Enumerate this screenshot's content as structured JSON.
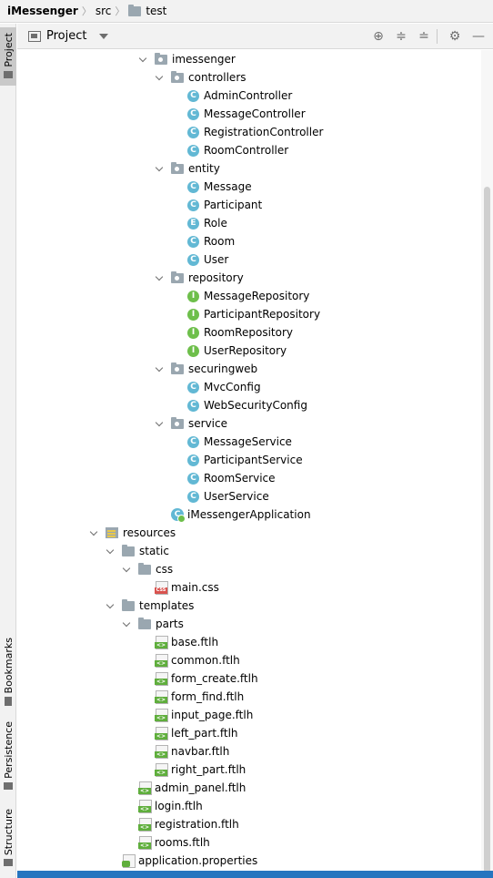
{
  "breadcrumb": {
    "project": "iMessenger",
    "src": "src",
    "test": "test"
  },
  "sidebar": {
    "project_tab": "Project",
    "bookmarks_tab": "Bookmarks",
    "persistence_tab": "Persistence",
    "structure_tab": "Structure"
  },
  "toolbar": {
    "title": "Project"
  },
  "tree": {
    "imessenger": "imessenger",
    "controllers": "controllers",
    "admin_controller": "AdminController",
    "message_controller": "MessageController",
    "registration_controller": "RegistrationController",
    "room_controller": "RoomController",
    "entity": "entity",
    "message": "Message",
    "participant": "Participant",
    "role": "Role",
    "room": "Room",
    "user": "User",
    "repository": "repository",
    "message_repository": "MessageRepository",
    "participant_repository": "ParticipantRepository",
    "room_repository": "RoomRepository",
    "user_repository": "UserRepository",
    "securingweb": "securingweb",
    "mvc_config": "MvcConfig",
    "web_security_config": "WebSecurityConfig",
    "service": "service",
    "message_service": "MessageService",
    "participant_service": "ParticipantService",
    "room_service": "RoomService",
    "user_service": "UserService",
    "app": "iMessengerApplication",
    "resources": "resources",
    "static": "static",
    "css": "css",
    "main_css": "main.css",
    "templates": "templates",
    "parts": "parts",
    "base": "base.ftlh",
    "common": "common.ftlh",
    "form_create": "form_create.ftlh",
    "form_find": "form_find.ftlh",
    "input_page": "input_page.ftlh",
    "left_part": "left_part.ftlh",
    "navbar": "navbar.ftlh",
    "right_part": "right_part.ftlh",
    "admin_panel": "admin_panel.ftlh",
    "login": "login.ftlh",
    "registration": "registration.ftlh",
    "rooms": "rooms.ftlh",
    "app_properties": "application.properties"
  },
  "icons": {
    "class_letter": "C",
    "interface_letter": "I",
    "enum_letter": "E"
  },
  "colors": {
    "class_icon": "#62b8d4",
    "interface_icon": "#6ebf4b",
    "selection": "#2675bf"
  }
}
